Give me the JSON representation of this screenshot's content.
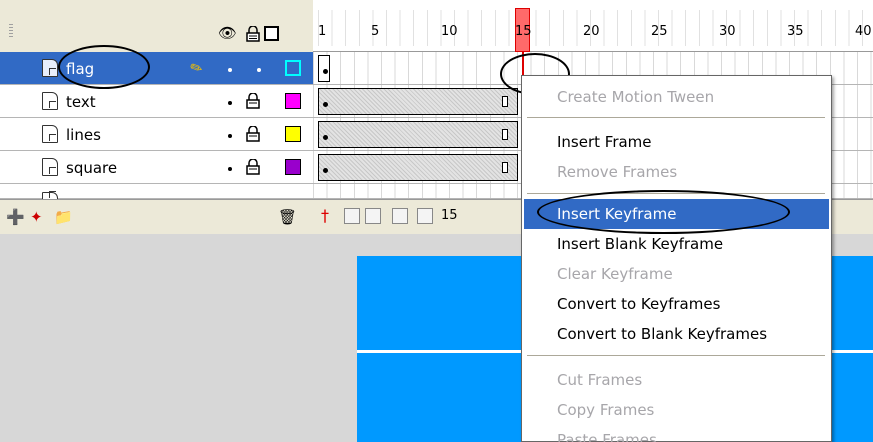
{
  "timeline": {
    "header_icons": [
      "eye-icon",
      "lock-icon",
      "outline-icon"
    ],
    "ruler_numbers": [
      "1",
      "5",
      "10",
      "15",
      "20",
      "25",
      "30",
      "35",
      "40"
    ],
    "current_frame": "15",
    "layers": [
      {
        "name": "flag",
        "selected": true,
        "color": "#00ffff"
      },
      {
        "name": "text",
        "selected": false,
        "color": "#ff00ff"
      },
      {
        "name": "lines",
        "selected": false,
        "color": "#ffff00"
      },
      {
        "name": "square",
        "selected": false,
        "color": "#9900cc"
      }
    ]
  },
  "context_menu": {
    "items": [
      {
        "label": "Create Motion Tween",
        "disabled": true
      },
      {
        "label": "Insert Frame",
        "disabled": false
      },
      {
        "label": "Remove Frames",
        "disabled": true
      },
      {
        "label": "Insert Keyframe",
        "disabled": false,
        "highlighted": true
      },
      {
        "label": "Insert Blank Keyframe",
        "disabled": false
      },
      {
        "label": "Clear Keyframe",
        "disabled": true
      },
      {
        "label": "Convert to Keyframes",
        "disabled": false
      },
      {
        "label": "Convert to Blank Keyframes",
        "disabled": false
      },
      {
        "label": "Cut Frames",
        "disabled": true
      },
      {
        "label": "Copy Frames",
        "disabled": true
      },
      {
        "label": "Paste Frames",
        "disabled": true
      }
    ]
  },
  "colors": {
    "selection": "#316ac5",
    "playhead": "#ff6a6a",
    "stage_fill": "#0099ff",
    "panel_bg": "#ece9d8"
  }
}
